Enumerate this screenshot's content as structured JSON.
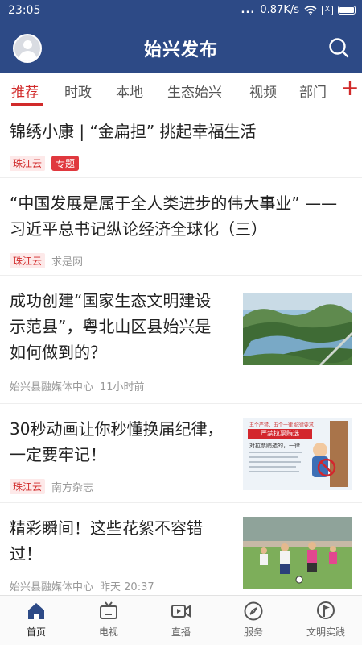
{
  "status_bar": {
    "time": "23:05",
    "dots": "...",
    "speed": "0.87K/s",
    "sim_label": "X"
  },
  "header": {
    "title": "始兴发布"
  },
  "tabs": [
    {
      "label": "推荐",
      "active": true
    },
    {
      "label": "时政",
      "active": false
    },
    {
      "label": "本地",
      "active": false
    },
    {
      "label": "生态始兴",
      "active": false
    },
    {
      "label": "视频",
      "active": false
    },
    {
      "label": "部门",
      "active": false
    }
  ],
  "tabs_add": "+",
  "articles": [
    {
      "title_lines": [
        "锦绣小康 | “金扁担” 挑起幸福生活"
      ],
      "source": "珠江云",
      "badge": "专题",
      "time": ""
    },
    {
      "title_lines": [
        "“中国发展是属于全人类进步的伟大事业” ——",
        "习近平总书记纵论经济全球化（三）"
      ],
      "source": "珠江云",
      "author": "求是网"
    },
    {
      "title_lines": [
        "成功创建“国家生态文明建设",
        "示范县”，粤北山区县始兴是",
        "如何做到的？"
      ],
      "source": "始兴县融媒体中心",
      "time": "11小时前",
      "thumb": "river-valley-photo"
    },
    {
      "title_lines": [
        "30秒动画让你秒懂换届纪律，",
        "一定要牢记！"
      ],
      "source": "珠江云",
      "author": "南方杂志",
      "thumb": "discipline-poster"
    },
    {
      "title_lines": [
        "精彩瞬间！这些花絮不容错",
        "过！"
      ],
      "source": "始兴县融媒体中心",
      "time": "昨天 20:37",
      "thumb": "football-match-photo"
    }
  ],
  "poster": {
    "banner": "严禁拉票贿选",
    "subtitle": "对拉票贿选的，一律",
    "top_note": "五个严禁、五个一律 纪律要求"
  },
  "bottom_nav": [
    {
      "label": "首页",
      "icon": "home-icon",
      "active": true
    },
    {
      "label": "电视",
      "icon": "tv-icon",
      "active": false
    },
    {
      "label": "直播",
      "icon": "live-video-icon",
      "active": false
    },
    {
      "label": "服务",
      "icon": "compass-icon",
      "active": false
    },
    {
      "label": "文明实践",
      "icon": "flag-pin-icon",
      "active": false
    }
  ],
  "colors": {
    "header_bg": "#2d4a86",
    "accent": "#d12a2a"
  }
}
